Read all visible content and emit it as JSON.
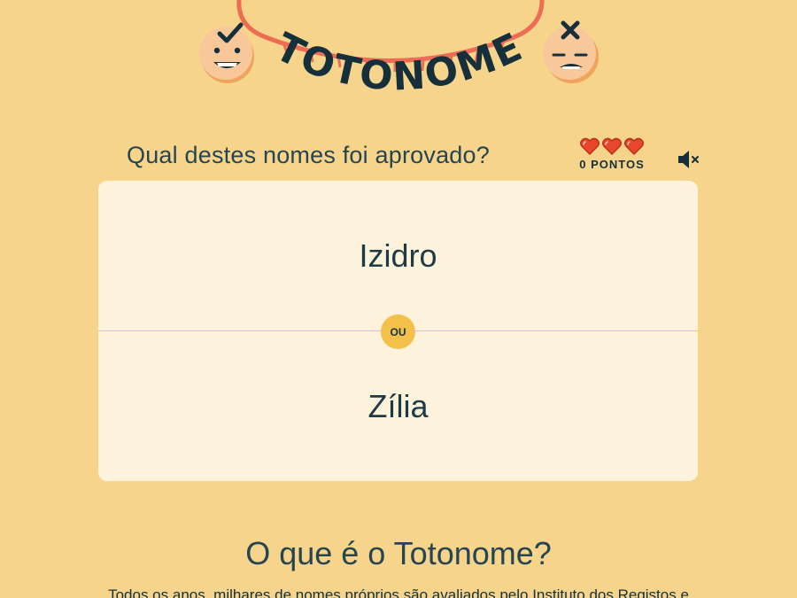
{
  "brand": {
    "logo_text": "TOTONOME"
  },
  "game": {
    "question": "Qual destes nomes foi aprovado?",
    "lives": 3,
    "points_label": "0 PONTOS",
    "option_a": "Izidro",
    "option_b": "Zília",
    "or_label": "OU"
  },
  "about": {
    "title": "O que é o Totonome?",
    "text": "Todos os anos, milhares de nomes próprios são avaliados pelo Instituto dos Registos e"
  },
  "colors": {
    "background": "#f6d48c",
    "card": "#fdf3dc",
    "accent": "#f3c04a",
    "heart": "#e8472b",
    "dark": "#15303a",
    "hoop": "#ec6c54"
  },
  "icons": {
    "mute": "speaker-muted-icon",
    "heart": "heart-icon"
  }
}
